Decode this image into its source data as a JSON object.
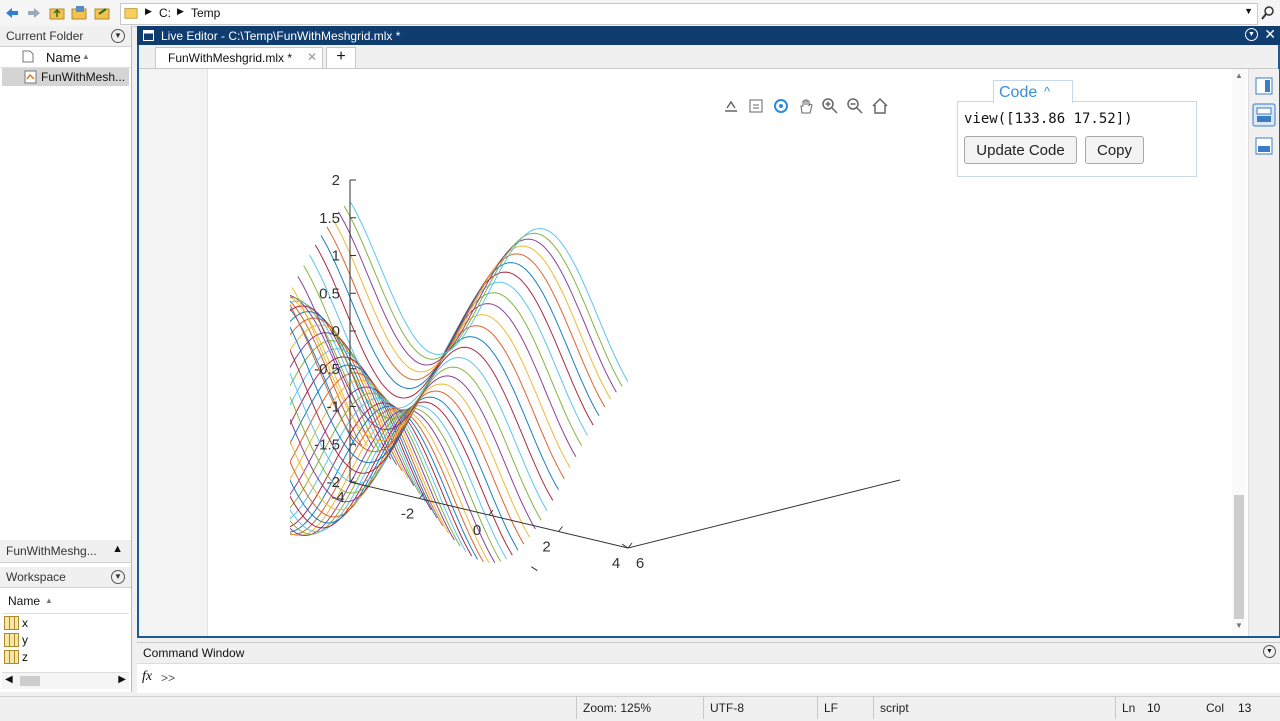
{
  "toolbar": {
    "path_segments": [
      "C:",
      "Temp"
    ]
  },
  "current_folder": {
    "title": "Current Folder",
    "column_name": "Name",
    "files": [
      {
        "name": "FunWithMesh..."
      }
    ],
    "details_title": "FunWithMeshg..."
  },
  "workspace": {
    "title": "Workspace",
    "column_name": "Name",
    "variables": [
      "x",
      "y",
      "z"
    ]
  },
  "editor": {
    "window_title": "Live Editor - C:\\Temp\\FunWithMeshgrid.mlx *",
    "tab_label": "FunWithMeshgrid.mlx *",
    "add_tab": "+"
  },
  "code_panel": {
    "title": "Code",
    "code_line": "view([133.86 17.52])",
    "update_button": "Update Code",
    "copy_button": "Copy"
  },
  "command_window": {
    "title": "Command Window",
    "fx": "fx",
    "prompt": ">>"
  },
  "status_bar": {
    "zoom": "Zoom: 125%",
    "encoding": "UTF-8",
    "line_ending": "LF",
    "mode": "script",
    "ln_label": "Ln",
    "ln_value": "10",
    "col_label": "Col",
    "col_value": "13"
  },
  "colors": {
    "title_bar": "#0f3d70",
    "accent": "#1c5a95",
    "code_link": "#3b8fd9"
  },
  "chart_data": {
    "type": "surface-mesh",
    "view": [
      133.86,
      17.52
    ],
    "x_ticks": [
      "-4",
      "-2",
      "0",
      "2",
      "4"
    ],
    "y_ticks": [
      "6",
      "4",
      "2",
      "0"
    ],
    "z_ticks": [
      "2",
      "1.5",
      "1",
      "0.5",
      "0",
      "-0.5",
      "-1",
      "-1.5",
      "-2"
    ],
    "xlim": [
      -4,
      4
    ],
    "ylim": [
      0,
      6
    ],
    "zlim": [
      -2,
      2
    ],
    "series_colors": [
      "#0072bd",
      "#d95319",
      "#edb120",
      "#7e2f8e",
      "#77ac30",
      "#4dbeee",
      "#a2142f"
    ]
  }
}
